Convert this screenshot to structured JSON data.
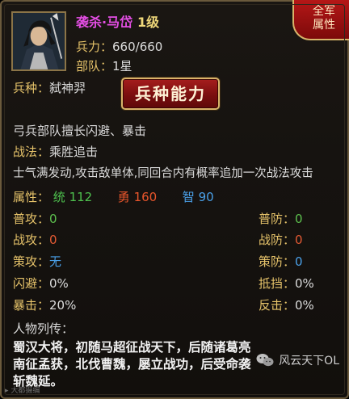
{
  "hero": {
    "name": "袭杀·马岱",
    "level": "1级",
    "troop_label": "兵力：",
    "troop_value": "660/660",
    "team_label": "部队：",
    "team_value": "1星"
  },
  "tab": {
    "line1": "全军",
    "line2": "属性"
  },
  "unit_type": {
    "label": "兵种：",
    "value": "弑神羿"
  },
  "ability_button": "兵种能力",
  "unit_desc": "弓兵部队擅长闪避、暴击",
  "tactic": {
    "label": "战法：",
    "name": "乘胜追击",
    "desc": "士气满发动,攻击敌单体,同回合内有概率追加一次战法攻击"
  },
  "attributes": {
    "label": "属性：",
    "tong_label": "统",
    "tong_value": "112",
    "yong_label": "勇",
    "yong_value": "160",
    "zhi_label": "智",
    "zhi_value": "90"
  },
  "stats": {
    "left": [
      {
        "label": "普攻：",
        "value": "0"
      },
      {
        "label": "战攻：",
        "value": "0"
      },
      {
        "label": "策攻：",
        "value": "无"
      },
      {
        "label": "闪避：",
        "value": "0%"
      },
      {
        "label": "暴击：",
        "value": "20%"
      }
    ],
    "right": [
      {
        "label": "普防：",
        "value": "0"
      },
      {
        "label": "战防：",
        "value": "0"
      },
      {
        "label": "策防：",
        "value": "0"
      },
      {
        "label": "抵挡：",
        "value": "0%"
      },
      {
        "label": "反击：",
        "value": "0%"
      }
    ]
  },
  "biography": {
    "title": "人物列传：",
    "text": "蜀汉大将，初随马超征战天下，后随诸葛亮南征孟获，北伐曹魏，屡立战功，后受命袭斩魏延。"
  },
  "watermark": {
    "left": "大都摄编",
    "right": "风云天下OL"
  },
  "colors": {
    "name": "#e44ee4",
    "label_gold": "#e6c36a",
    "value_green": "#5dc04e",
    "value_red": "#e35a33",
    "value_blue": "#4aa0e8",
    "button_red": "#a61d1d"
  }
}
